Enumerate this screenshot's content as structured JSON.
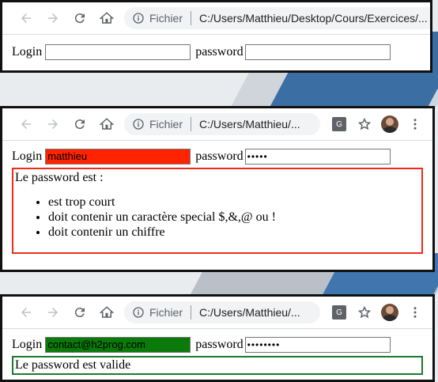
{
  "panels": [
    {
      "url_scheme": "Fichier",
      "url": "C:/Users/Matthieu/Desktop/Cours/Exercices/...",
      "form": {
        "login_label": "Login",
        "login_value": "",
        "password_label": "password",
        "password_value": ""
      }
    },
    {
      "url_scheme": "Fichier",
      "url": "C:/Users/Matthieu/...",
      "form": {
        "login_label": "Login",
        "login_value": "matthieu",
        "password_label": "password",
        "password_value": "•••••"
      },
      "message": {
        "title": "Le password est :",
        "errors": [
          "est trop court",
          "doit contenir un caractère special $,&,@ ou !",
          "doit contenir un chiffre"
        ]
      }
    },
    {
      "url_scheme": "Fichier",
      "url": "C:/Users/Matthieu/...",
      "form": {
        "login_label": "Login",
        "login_value": "contact@h2prog.com",
        "password_label": "password",
        "password_value": "••••••••"
      },
      "message": {
        "text": "Le password est valide"
      }
    }
  ],
  "colors": {
    "error_field": "#ff2400",
    "error_border": "#ee2a1b",
    "valid_field": "#0a7a0a",
    "valid_border": "#1b7a2b"
  },
  "icons": [
    "back-arrow-icon",
    "forward-arrow-icon",
    "reload-icon",
    "home-icon",
    "info-icon",
    "translate-icon",
    "star-icon",
    "avatar",
    "menu-dots-icon"
  ]
}
